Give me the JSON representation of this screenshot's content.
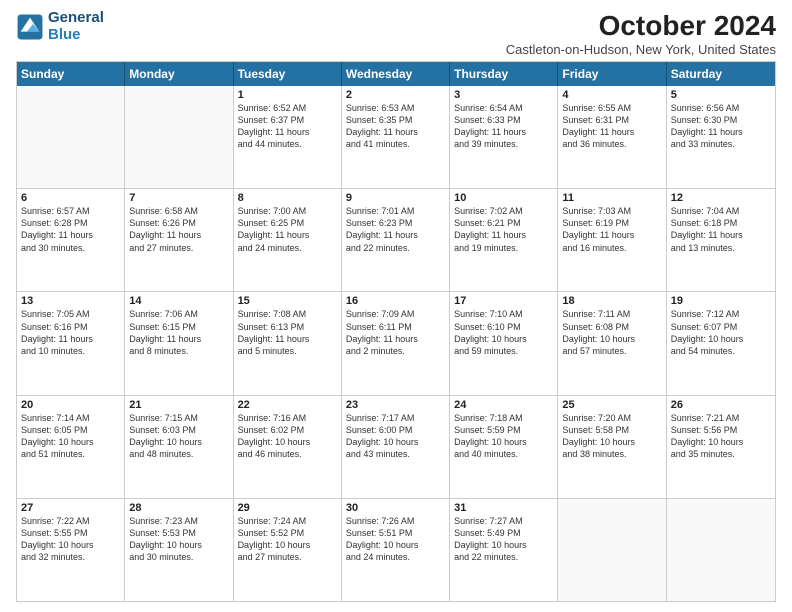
{
  "header": {
    "logo_line1": "General",
    "logo_line2": "Blue",
    "title": "October 2024",
    "subtitle": "Castleton-on-Hudson, New York, United States"
  },
  "days_of_week": [
    "Sunday",
    "Monday",
    "Tuesday",
    "Wednesday",
    "Thursday",
    "Friday",
    "Saturday"
  ],
  "rows": [
    [
      {
        "day": "",
        "empty": true
      },
      {
        "day": "",
        "empty": true
      },
      {
        "day": "1",
        "line1": "Sunrise: 6:52 AM",
        "line2": "Sunset: 6:37 PM",
        "line3": "Daylight: 11 hours",
        "line4": "and 44 minutes."
      },
      {
        "day": "2",
        "line1": "Sunrise: 6:53 AM",
        "line2": "Sunset: 6:35 PM",
        "line3": "Daylight: 11 hours",
        "line4": "and 41 minutes."
      },
      {
        "day": "3",
        "line1": "Sunrise: 6:54 AM",
        "line2": "Sunset: 6:33 PM",
        "line3": "Daylight: 11 hours",
        "line4": "and 39 minutes."
      },
      {
        "day": "4",
        "line1": "Sunrise: 6:55 AM",
        "line2": "Sunset: 6:31 PM",
        "line3": "Daylight: 11 hours",
        "line4": "and 36 minutes."
      },
      {
        "day": "5",
        "line1": "Sunrise: 6:56 AM",
        "line2": "Sunset: 6:30 PM",
        "line3": "Daylight: 11 hours",
        "line4": "and 33 minutes."
      }
    ],
    [
      {
        "day": "6",
        "line1": "Sunrise: 6:57 AM",
        "line2": "Sunset: 6:28 PM",
        "line3": "Daylight: 11 hours",
        "line4": "and 30 minutes."
      },
      {
        "day": "7",
        "line1": "Sunrise: 6:58 AM",
        "line2": "Sunset: 6:26 PM",
        "line3": "Daylight: 11 hours",
        "line4": "and 27 minutes."
      },
      {
        "day": "8",
        "line1": "Sunrise: 7:00 AM",
        "line2": "Sunset: 6:25 PM",
        "line3": "Daylight: 11 hours",
        "line4": "and 24 minutes."
      },
      {
        "day": "9",
        "line1": "Sunrise: 7:01 AM",
        "line2": "Sunset: 6:23 PM",
        "line3": "Daylight: 11 hours",
        "line4": "and 22 minutes."
      },
      {
        "day": "10",
        "line1": "Sunrise: 7:02 AM",
        "line2": "Sunset: 6:21 PM",
        "line3": "Daylight: 11 hours",
        "line4": "and 19 minutes."
      },
      {
        "day": "11",
        "line1": "Sunrise: 7:03 AM",
        "line2": "Sunset: 6:19 PM",
        "line3": "Daylight: 11 hours",
        "line4": "and 16 minutes."
      },
      {
        "day": "12",
        "line1": "Sunrise: 7:04 AM",
        "line2": "Sunset: 6:18 PM",
        "line3": "Daylight: 11 hours",
        "line4": "and 13 minutes."
      }
    ],
    [
      {
        "day": "13",
        "line1": "Sunrise: 7:05 AM",
        "line2": "Sunset: 6:16 PM",
        "line3": "Daylight: 11 hours",
        "line4": "and 10 minutes."
      },
      {
        "day": "14",
        "line1": "Sunrise: 7:06 AM",
        "line2": "Sunset: 6:15 PM",
        "line3": "Daylight: 11 hours",
        "line4": "and 8 minutes."
      },
      {
        "day": "15",
        "line1": "Sunrise: 7:08 AM",
        "line2": "Sunset: 6:13 PM",
        "line3": "Daylight: 11 hours",
        "line4": "and 5 minutes."
      },
      {
        "day": "16",
        "line1": "Sunrise: 7:09 AM",
        "line2": "Sunset: 6:11 PM",
        "line3": "Daylight: 11 hours",
        "line4": "and 2 minutes."
      },
      {
        "day": "17",
        "line1": "Sunrise: 7:10 AM",
        "line2": "Sunset: 6:10 PM",
        "line3": "Daylight: 10 hours",
        "line4": "and 59 minutes."
      },
      {
        "day": "18",
        "line1": "Sunrise: 7:11 AM",
        "line2": "Sunset: 6:08 PM",
        "line3": "Daylight: 10 hours",
        "line4": "and 57 minutes."
      },
      {
        "day": "19",
        "line1": "Sunrise: 7:12 AM",
        "line2": "Sunset: 6:07 PM",
        "line3": "Daylight: 10 hours",
        "line4": "and 54 minutes."
      }
    ],
    [
      {
        "day": "20",
        "line1": "Sunrise: 7:14 AM",
        "line2": "Sunset: 6:05 PM",
        "line3": "Daylight: 10 hours",
        "line4": "and 51 minutes."
      },
      {
        "day": "21",
        "line1": "Sunrise: 7:15 AM",
        "line2": "Sunset: 6:03 PM",
        "line3": "Daylight: 10 hours",
        "line4": "and 48 minutes."
      },
      {
        "day": "22",
        "line1": "Sunrise: 7:16 AM",
        "line2": "Sunset: 6:02 PM",
        "line3": "Daylight: 10 hours",
        "line4": "and 46 minutes."
      },
      {
        "day": "23",
        "line1": "Sunrise: 7:17 AM",
        "line2": "Sunset: 6:00 PM",
        "line3": "Daylight: 10 hours",
        "line4": "and 43 minutes."
      },
      {
        "day": "24",
        "line1": "Sunrise: 7:18 AM",
        "line2": "Sunset: 5:59 PM",
        "line3": "Daylight: 10 hours",
        "line4": "and 40 minutes."
      },
      {
        "day": "25",
        "line1": "Sunrise: 7:20 AM",
        "line2": "Sunset: 5:58 PM",
        "line3": "Daylight: 10 hours",
        "line4": "and 38 minutes."
      },
      {
        "day": "26",
        "line1": "Sunrise: 7:21 AM",
        "line2": "Sunset: 5:56 PM",
        "line3": "Daylight: 10 hours",
        "line4": "and 35 minutes."
      }
    ],
    [
      {
        "day": "27",
        "line1": "Sunrise: 7:22 AM",
        "line2": "Sunset: 5:55 PM",
        "line3": "Daylight: 10 hours",
        "line4": "and 32 minutes."
      },
      {
        "day": "28",
        "line1": "Sunrise: 7:23 AM",
        "line2": "Sunset: 5:53 PM",
        "line3": "Daylight: 10 hours",
        "line4": "and 30 minutes."
      },
      {
        "day": "29",
        "line1": "Sunrise: 7:24 AM",
        "line2": "Sunset: 5:52 PM",
        "line3": "Daylight: 10 hours",
        "line4": "and 27 minutes."
      },
      {
        "day": "30",
        "line1": "Sunrise: 7:26 AM",
        "line2": "Sunset: 5:51 PM",
        "line3": "Daylight: 10 hours",
        "line4": "and 24 minutes."
      },
      {
        "day": "31",
        "line1": "Sunrise: 7:27 AM",
        "line2": "Sunset: 5:49 PM",
        "line3": "Daylight: 10 hours",
        "line4": "and 22 minutes."
      },
      {
        "day": "",
        "empty": true
      },
      {
        "day": "",
        "empty": true
      }
    ]
  ]
}
